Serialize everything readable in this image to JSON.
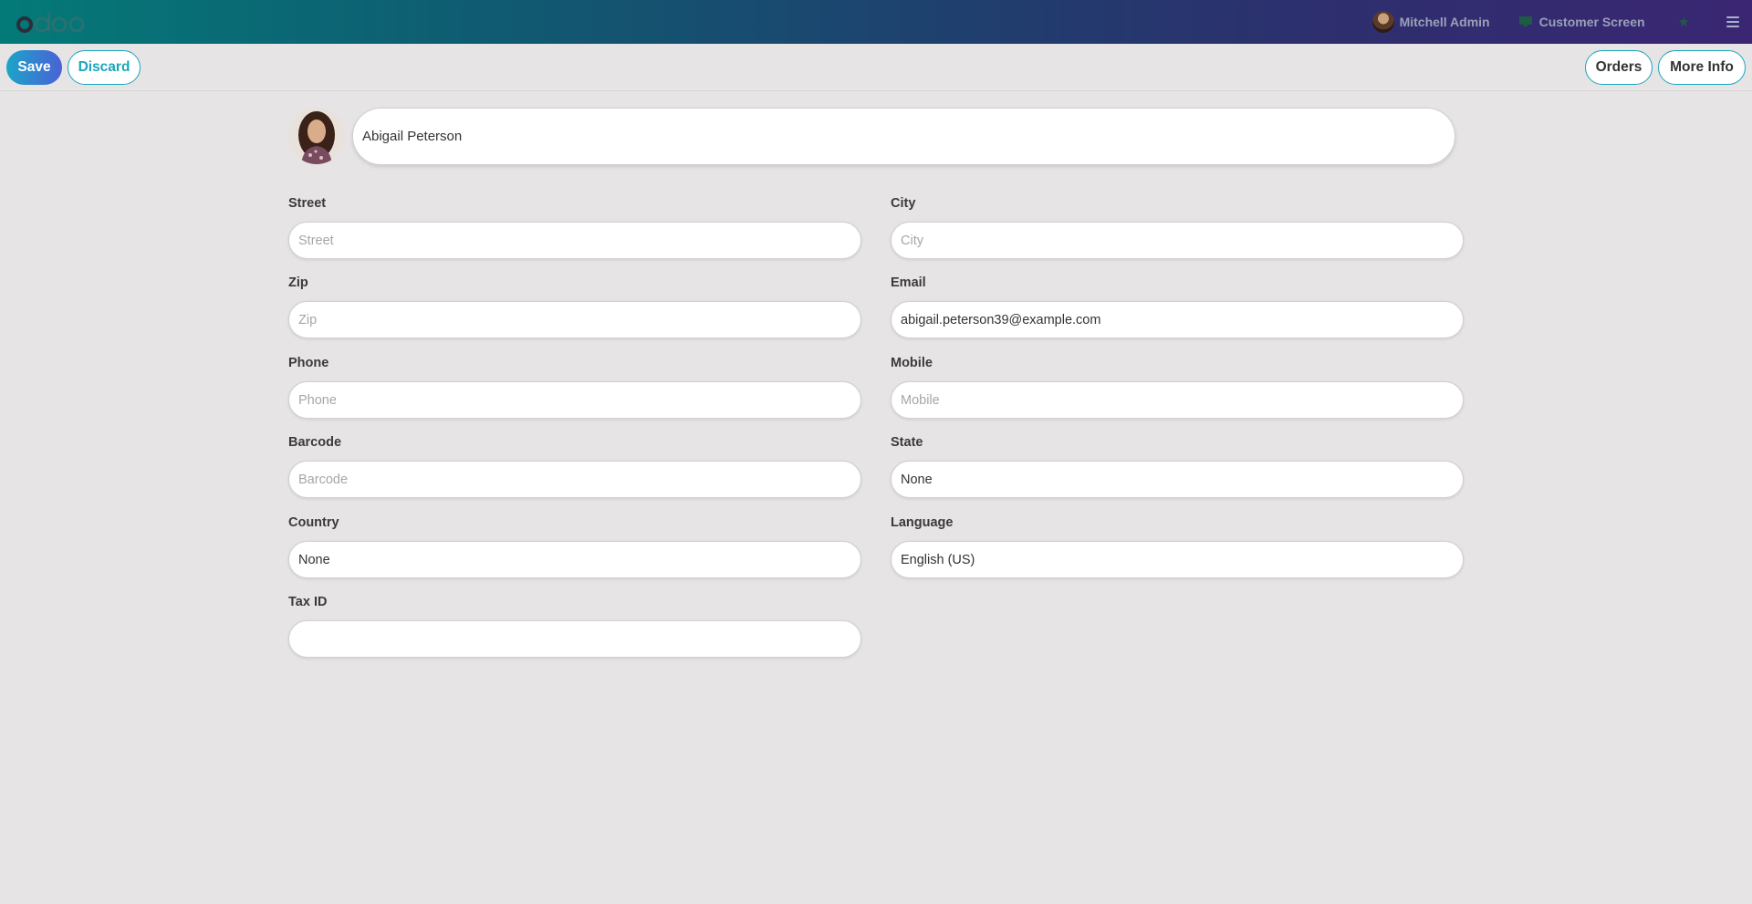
{
  "navbar": {
    "user_name": "Mitchell Admin",
    "customer_screen": "Customer Screen",
    "icons": [
      "odoo-logo",
      "user-avatar",
      "monitor-icon",
      "star-icon",
      "hamburger-menu-icon"
    ]
  },
  "control": {
    "save": "Save",
    "discard": "Discard",
    "orders": "Orders",
    "more_info": "More Info"
  },
  "customer": {
    "name": "Abigail Peterson"
  },
  "fields": {
    "street": {
      "label": "Street",
      "placeholder": "Street",
      "value": ""
    },
    "city": {
      "label": "City",
      "placeholder": "City",
      "value": ""
    },
    "zip": {
      "label": "Zip",
      "placeholder": "Zip",
      "value": ""
    },
    "email": {
      "label": "Email",
      "placeholder": "",
      "value": "abigail.peterson39@example.com"
    },
    "phone": {
      "label": "Phone",
      "placeholder": "Phone",
      "value": ""
    },
    "mobile": {
      "label": "Mobile",
      "placeholder": "Mobile",
      "value": ""
    },
    "barcode": {
      "label": "Barcode",
      "placeholder": "Barcode",
      "value": ""
    },
    "state": {
      "label": "State",
      "placeholder": "",
      "value": "None"
    },
    "country": {
      "label": "Country",
      "placeholder": "",
      "value": "None"
    },
    "language": {
      "label": "Language",
      "placeholder": "",
      "value": "English (US)"
    },
    "tax_id": {
      "label": "Tax ID",
      "placeholder": "",
      "value": ""
    }
  },
  "colors": {
    "accent": "#1aa6bc",
    "background": "#e6e4e4",
    "navbar_start": "#047a78",
    "navbar_end": "#3a2672"
  }
}
